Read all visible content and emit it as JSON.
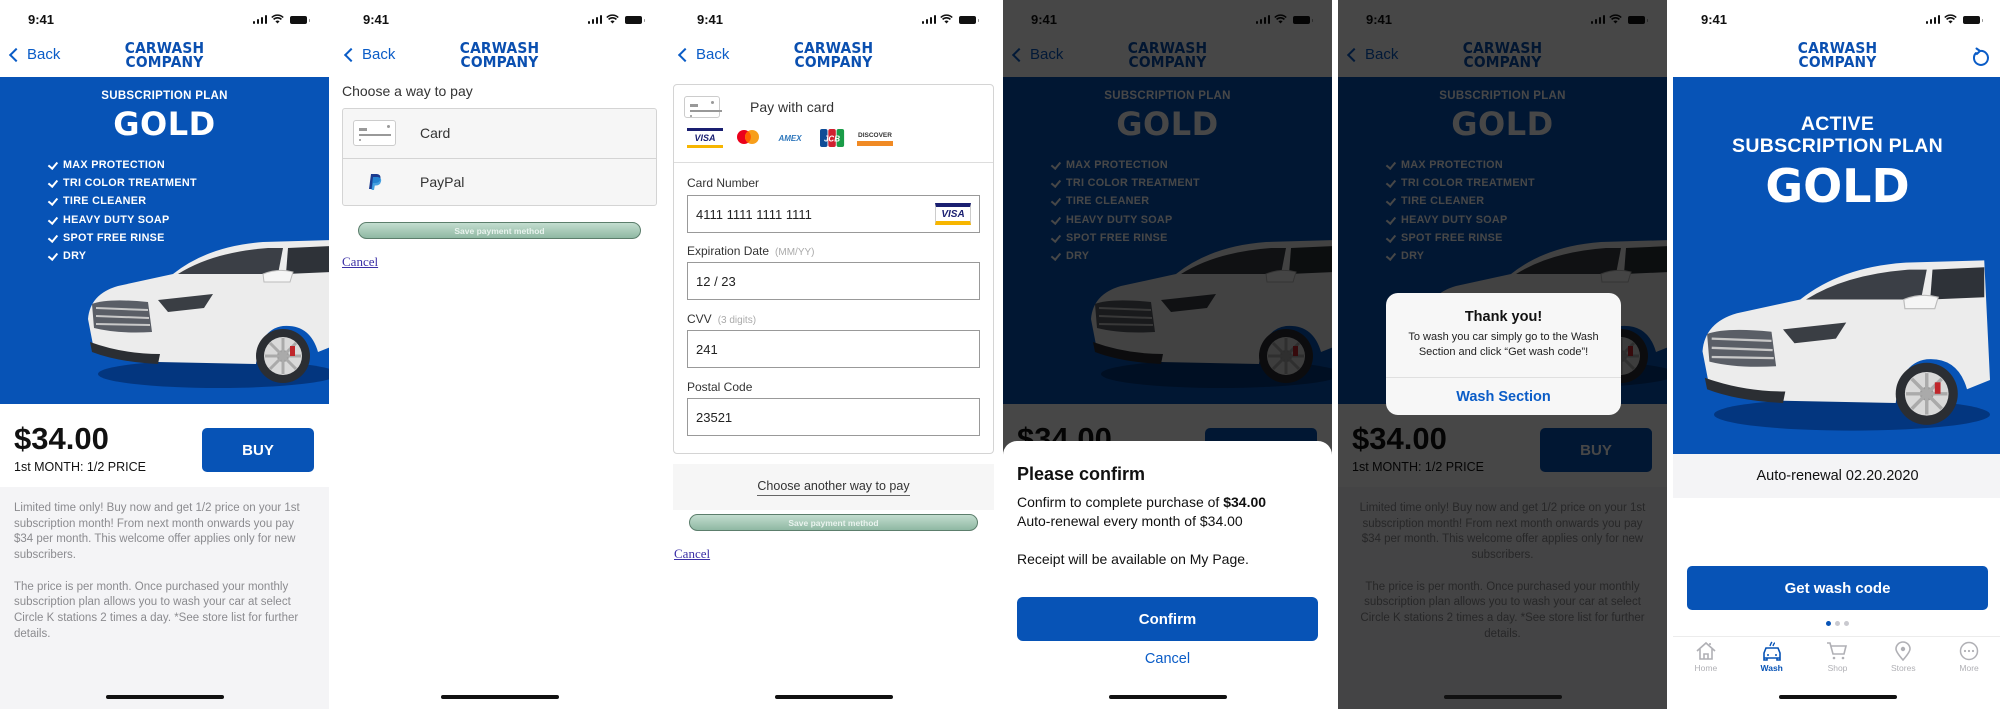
{
  "status_bar": {
    "time": "9:41"
  },
  "nav": {
    "back_label": "Back",
    "logo_line1": "CARWASH",
    "logo_line2": "COMPANY"
  },
  "plan": {
    "subtitle": "SUBSCRIPTION PLAN",
    "name": "GOLD",
    "features": [
      "MAX PROTECTION",
      "TRI COLOR TREATMENT",
      "TIRE CLEANER",
      "HEAVY DUTY SOAP",
      "SPOT FREE RINSE",
      "DRY"
    ],
    "price": "$34.00",
    "price_note": "1st MONTH: 1/2 PRICE",
    "buy_label": "BUY",
    "description": [
      "Limited time only! Buy now and get 1/2 price on your 1st subscription month! From next month onwards you pay $34 per month. This welcome offer applies only for new subscribers.",
      "The price is per month. Once purchased your monthly subscription plan allows you to wash your car at select Circle K stations 2 times a day. *See store list for further details."
    ]
  },
  "payment_choice": {
    "title": "Choose a way to pay",
    "options": [
      {
        "label": "Card",
        "icon": "credit-card-icon"
      },
      {
        "label": "PayPal",
        "icon": "paypal-icon"
      }
    ],
    "save_label": "Save payment method",
    "cancel_label": "Cancel"
  },
  "card_form": {
    "title": "Pay with card",
    "brands": [
      "VISA",
      "Mastercard",
      "AMEX",
      "JCB",
      "DISCOVER"
    ],
    "card_number": {
      "label": "Card Number",
      "value": "4111 1111 1111 1111",
      "detected_brand": "VISA"
    },
    "expiration": {
      "label": "Expiration Date",
      "hint": "(MM/YY)",
      "value": "12 / 23"
    },
    "cvv": {
      "label": "CVV",
      "hint": "(3 digits)",
      "value": "241"
    },
    "postal": {
      "label": "Postal Code",
      "value": "23521"
    },
    "choose_another_label": "Choose another way to pay",
    "save_label": "Save payment method",
    "cancel_label": "Cancel"
  },
  "confirm_sheet": {
    "title": "Please confirm",
    "line1_prefix": "Confirm to complete purchase of ",
    "line1_amount": "$34.00",
    "line2": "Auto-renewal every month of $34.00",
    "line3": "Receipt will be available on My Page.",
    "confirm_label": "Confirm",
    "cancel_label": "Cancel"
  },
  "thank_you_alert": {
    "title": "Thank you!",
    "message": "To wash you car simply go to the Wash Section and click “Get wash code”!",
    "button_label": "Wash Section"
  },
  "active_plan": {
    "line1": "ACTIVE",
    "line2": "SUBSCRIPTION PLAN",
    "name": "GOLD",
    "renewal": "Auto-renewal 02.20.2020",
    "get_code_label": "Get wash code",
    "page_indicator": {
      "count": 3,
      "current": 1
    },
    "tabs": [
      {
        "label": "Home",
        "icon": "home-icon",
        "active": false
      },
      {
        "label": "Wash",
        "icon": "car-wash-icon",
        "active": true
      },
      {
        "label": "Shop",
        "icon": "cart-icon",
        "active": false
      },
      {
        "label": "Stores",
        "icon": "location-pin-icon",
        "active": false
      },
      {
        "label": "More",
        "icon": "more-icon",
        "active": false
      }
    ]
  },
  "colors": {
    "brand_blue": "#0753b6",
    "link_blue": "#0a5cc7",
    "description_gray": "#8b8b8f",
    "panel_gray": "#f4f4f6"
  }
}
